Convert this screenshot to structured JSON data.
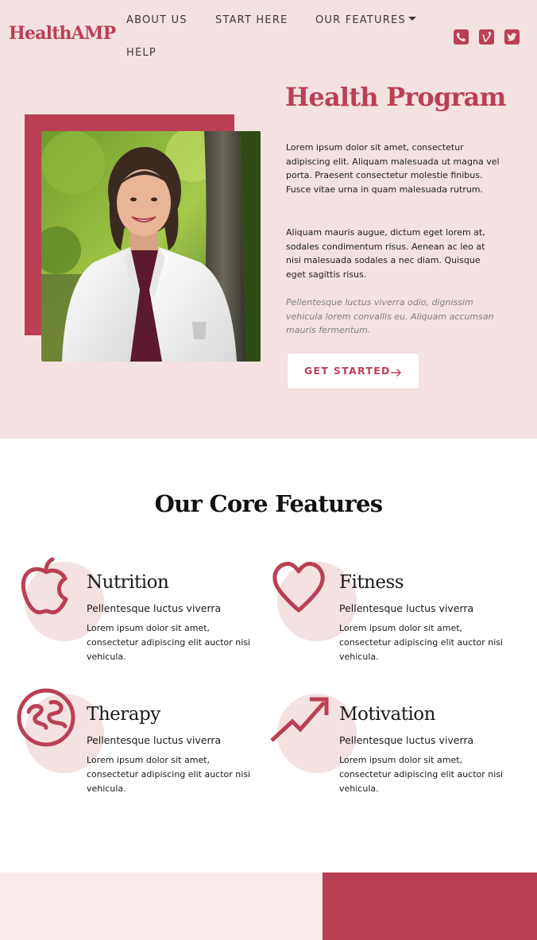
{
  "brand": {
    "name": "HealthAMP",
    "accent": "#bb3f54",
    "hero_bg": "#f4e1e1"
  },
  "nav": {
    "items": [
      {
        "label": "ABOUT US"
      },
      {
        "label": "START HERE"
      },
      {
        "label": "OUR FEATURES",
        "icon": "caret-down-icon"
      },
      {
        "label": "HELP"
      }
    ]
  },
  "social": [
    "phone-icon",
    "vimeo-icon",
    "twitter-icon"
  ],
  "hero": {
    "title": "Health Program",
    "paragraph1": "Lorem ipsum dolor sit amet, consectetur adipiscing elit. Aliquam malesuada ut magna vel porta. Praesent consectetur molestie finibus. Fusce vitae urna in quam malesuada rutrum.",
    "paragraph2": "Aliquam mauris augue, dictum eget lorem at, sodales condimentum risus. Aenean ac leo at nisi malesuada sodales a nec diam. Quisque eget sagittis risus.",
    "paragraph3": "Pellentesque luctus viverra odio, dignissim vehicula lorem convallis eu. Aliquam accumsan mauris fermentum.",
    "cta_label": "GET STARTED",
    "cta_icon": "arrow-right-icon"
  },
  "features": {
    "title": "Our Core Features",
    "items": [
      {
        "title": "Nutrition",
        "subtitle": "Pellentesque luctus viverra",
        "desc": "Lorem ipsum dolor sit amet, consectetur adipiscing elit auctor nisi vehicula.",
        "icon": "apple-icon"
      },
      {
        "title": "Fitness",
        "subtitle": "Pellentesque luctus viverra",
        "desc": "Lorem ipsum dolor sit amet, consectetur adipiscing elit auctor nisi vehicula.",
        "icon": "heart-icon"
      },
      {
        "title": "Therapy",
        "subtitle": "Pellentesque luctus viverra",
        "desc": "Lorem ipsum dolor sit amet, consectetur adipiscing elit auctor nisi vehicula.",
        "icon": "brain-icon"
      },
      {
        "title": "Motivation",
        "subtitle": "Pellentesque luctus viverra",
        "desc": "Lorem ipsum dolor sit amet, consectetur adipiscing elit auctor nisi vehicula.",
        "icon": "trending-up-icon"
      }
    ]
  }
}
